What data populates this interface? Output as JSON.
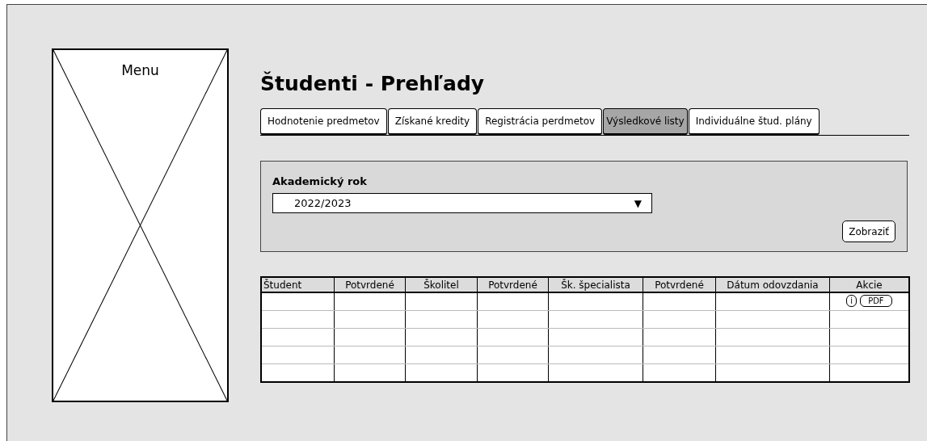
{
  "menu": {
    "label": "Menu"
  },
  "title": "Študenti - Prehľady",
  "tabs": [
    {
      "label": "Hodnotenie predmetov",
      "selected": false
    },
    {
      "label": "Získané kredity",
      "selected": false
    },
    {
      "label": "Registrácia perdmetov",
      "selected": false
    },
    {
      "label": "Výsledkové listy",
      "selected": true
    },
    {
      "label": "Individuálne štud. plány",
      "selected": false
    }
  ],
  "filter": {
    "label": "Akademický rok",
    "dropdown": {
      "value": "2022/2023",
      "arrow": "▼"
    },
    "button": "Zobraziť"
  },
  "table": {
    "columns": [
      "Študent",
      "Potvrdené",
      "Školitel",
      "Potvrdené",
      "Šk. špecialista",
      "Potvrdené",
      "Dátum odovzdania",
      "Akcie"
    ],
    "rows": [
      {
        "kind": "actions",
        "actions": [
          "i",
          "PDF"
        ]
      },
      {
        "kind": "blank"
      },
      {
        "kind": "blank"
      },
      {
        "kind": "blank"
      },
      {
        "kind": "blank"
      }
    ]
  }
}
